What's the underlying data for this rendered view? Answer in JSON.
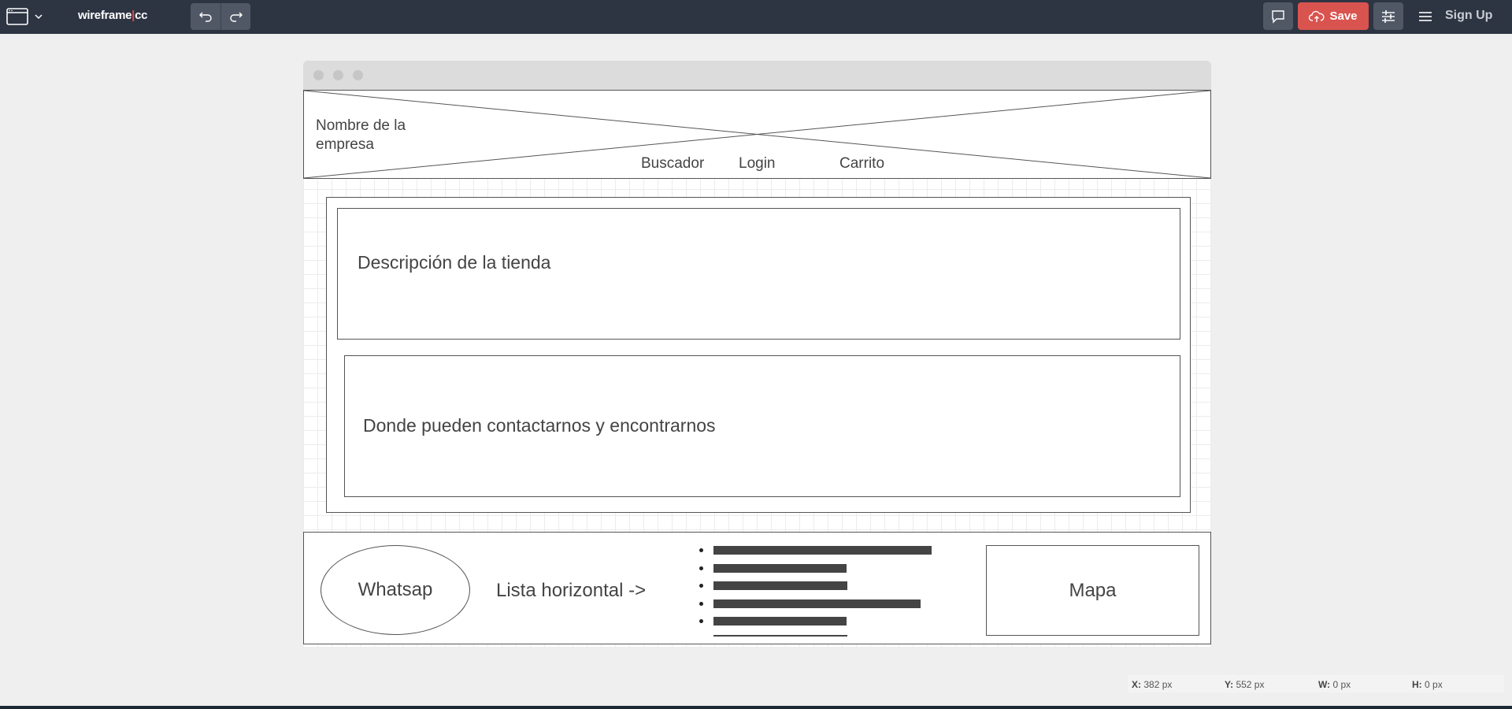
{
  "app": {
    "logo_main": "wireframe",
    "logo_sep": "|",
    "logo_suffix": "cc",
    "save_label": "Save",
    "signup_label": "Sign Up",
    "accent": "#d9534f",
    "toolbar_bg": "#2d3442"
  },
  "icons": {
    "window": "browser-window-icon",
    "dropdown": "chevron-down-icon",
    "undo": "undo-icon",
    "redo": "redo-icon",
    "comment": "comment-icon",
    "cloud": "cloud-upload-icon",
    "settings": "sliders-icon",
    "menu": "hamburger-menu-icon"
  },
  "wireframe": {
    "header": {
      "company_name": "Nombre de la empresa",
      "nav": [
        "Buscador",
        "Login",
        "Carrito"
      ]
    },
    "description": "Descripción de la tienda",
    "contact": "Donde pueden contactarnos y encontrarnos",
    "footer": {
      "whatsapp": "Whatsap",
      "list_label": "Lista horizontal ->",
      "map": "Mapa",
      "list_bars": [
        {
          "fraction": 1.0
        },
        {
          "fraction": 0.61
        },
        {
          "fraction": 0.615
        },
        {
          "fraction": 0.95
        },
        {
          "fraction": 0.61
        }
      ]
    }
  },
  "status": {
    "x_label": "X:",
    "x_value": "382 px",
    "y_label": "Y:",
    "y_value": "552 px",
    "w_label": "W:",
    "w_value": "0 px",
    "h_label": "H:",
    "h_value": "0 px"
  }
}
